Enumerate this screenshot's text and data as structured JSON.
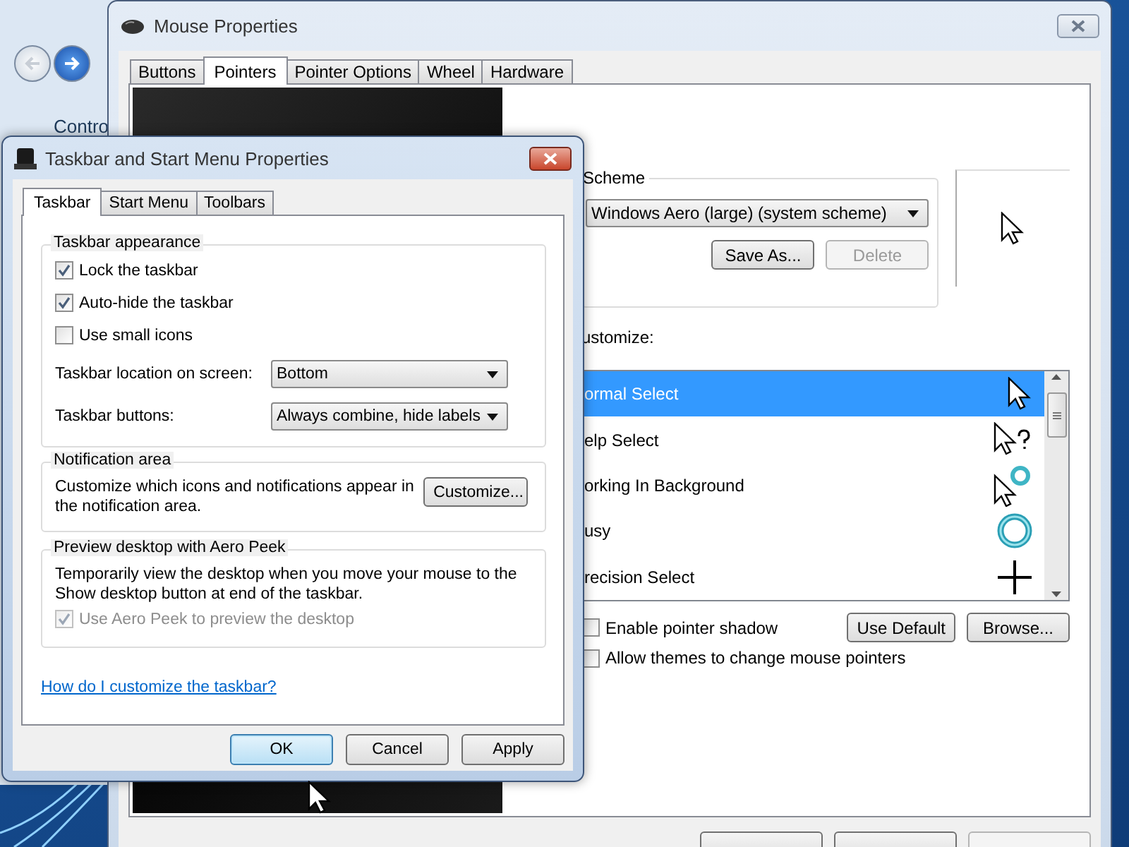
{
  "background_window": {
    "nav_label": "Contro"
  },
  "mouse_window": {
    "title": "Mouse Properties",
    "tabs": [
      {
        "label": "Buttons",
        "selected": false
      },
      {
        "label": "Pointers",
        "selected": true
      },
      {
        "label": "Pointer Options",
        "selected": false
      },
      {
        "label": "Wheel",
        "selected": false
      },
      {
        "label": "Hardware",
        "selected": false
      }
    ],
    "scheme": {
      "label": "Scheme",
      "value": "Windows Aero (large) (system scheme)",
      "buttons": [
        {
          "label": "Save As...",
          "disabled": false
        },
        {
          "label": "Delete",
          "disabled": true
        }
      ]
    },
    "customize_label": "ustomize:",
    "pointers": [
      {
        "name": "ormal Select",
        "kind": "normal",
        "selected": true
      },
      {
        "name": "elp Select",
        "kind": "help",
        "selected": false
      },
      {
        "name": "orking In Background",
        "kind": "working",
        "selected": false
      },
      {
        "name": "usy",
        "kind": "busy",
        "selected": false
      },
      {
        "name": "recision Select",
        "kind": "precision",
        "selected": false
      }
    ],
    "options": [
      {
        "label": "Enable pointer shadow",
        "checked": false
      },
      {
        "label": "Allow themes to change mouse pointers",
        "checked": false
      }
    ],
    "buttons": [
      "Use Default",
      "Browse..."
    ]
  },
  "taskbar_dialog": {
    "title": "Taskbar and Start Menu Properties",
    "tabs": [
      {
        "label": "Taskbar",
        "selected": true
      },
      {
        "label": "Start Menu",
        "selected": false
      },
      {
        "label": "Toolbars",
        "selected": false
      }
    ],
    "appearance": {
      "heading": "Taskbar appearance",
      "checkboxes": [
        {
          "label": "Lock the taskbar",
          "checked": true
        },
        {
          "label": "Auto-hide the taskbar",
          "checked": true
        },
        {
          "label": "Use small icons",
          "checked": false
        }
      ],
      "selects": [
        {
          "label": "Taskbar location on screen:",
          "value": "Bottom"
        },
        {
          "label": "Taskbar buttons:",
          "value": "Always combine, hide labels"
        }
      ]
    },
    "notification": {
      "heading": "Notification area",
      "text": "Customize which icons and notifications appear in the notification area.",
      "button": "Customize..."
    },
    "peek": {
      "heading": "Preview desktop with Aero Peek",
      "text": "Temporarily view the desktop when you move your mouse to the Show desktop button at end of the taskbar.",
      "checkbox": {
        "label": "Use Aero Peek to preview the desktop",
        "checked": true,
        "disabled": true
      }
    },
    "help_link": "How do I customize the taskbar?",
    "buttons": [
      {
        "label": "OK",
        "default": true
      },
      {
        "label": "Cancel",
        "default": false
      },
      {
        "label": "Apply",
        "default": false
      }
    ]
  }
}
